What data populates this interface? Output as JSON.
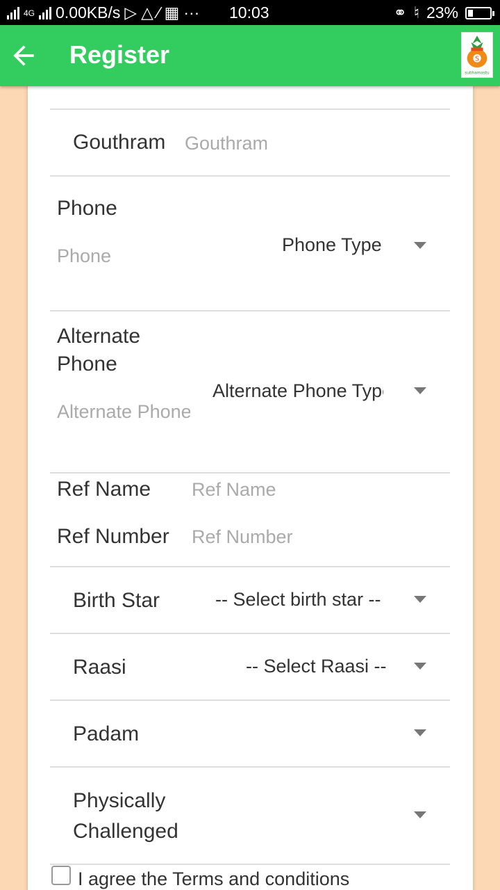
{
  "status_bar": {
    "network": "4G",
    "speed": "0.00KB/s",
    "dots": "···",
    "time": "10:03",
    "battery": "23%",
    "battery_level": 0.23
  },
  "app_bar": {
    "title": "Register",
    "logo_text": "subhamastu",
    "logo_symbol": "S"
  },
  "form": {
    "gouthram": {
      "label": "Gouthram",
      "placeholder": "Gouthram"
    },
    "phone": {
      "label": "Phone",
      "placeholder": "Phone",
      "type_select": "Phone Type"
    },
    "alt_phone": {
      "label_line1": "Alternate",
      "label_line2": "Phone",
      "placeholder": "Alternate Phone",
      "type_select": "Alternate Phone Type"
    },
    "ref_name": {
      "label": "Ref Name",
      "placeholder": "Ref Name"
    },
    "ref_number": {
      "label": "Ref Number",
      "placeholder": "Ref Number"
    },
    "birth_star": {
      "label": "Birth Star",
      "select": "-- Select birth star --"
    },
    "raasi": {
      "label": "Raasi",
      "select": "-- Select Raasi --"
    },
    "padam": {
      "label": "Padam",
      "select": ""
    },
    "physically_challenged": {
      "label_line1": "Physically",
      "label_line2": "Challenged",
      "select": ""
    },
    "terms": {
      "label": "I agree the Terms and conditions"
    }
  },
  "colors": {
    "app_bar": "#33cc5e",
    "page_background": "#fcd8b4"
  }
}
